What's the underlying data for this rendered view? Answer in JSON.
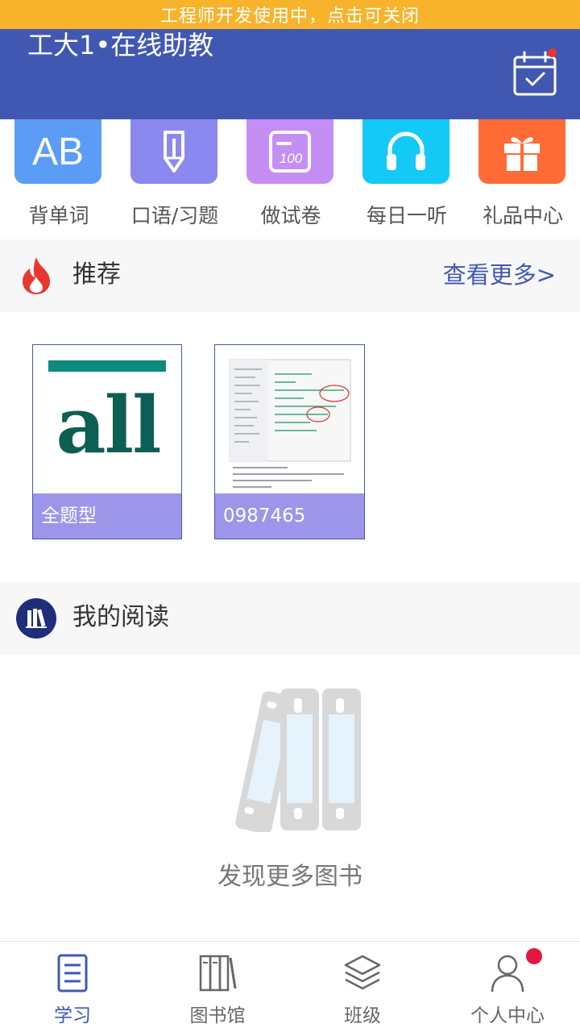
{
  "dev_banner": {
    "text": "工程师开发使用中，点击可关闭"
  },
  "header": {
    "title": "工大1•在线助教",
    "calendar_icon": "calendar-check-icon",
    "badge_color": "#e8352f"
  },
  "quick_actions": [
    {
      "label": "背单词",
      "icon": "ab-letters-icon",
      "color": "#5b9cf7"
    },
    {
      "label": "口语/习题",
      "icon": "pencil-icon",
      "color": "#8b88f0"
    },
    {
      "label": "做试卷",
      "icon": "exam-paper-icon",
      "color": "#c58ef4"
    },
    {
      "label": "每日一听",
      "icon": "headphones-icon",
      "color": "#14c9f5"
    },
    {
      "label": "礼品中心",
      "icon": "gift-icon",
      "color": "#ff6b35"
    }
  ],
  "recommend": {
    "title": "推荐",
    "more": "查看更多>",
    "books": [
      {
        "cover_text": "all",
        "caption": "全题型"
      },
      {
        "caption": "0987465"
      }
    ]
  },
  "my_reading": {
    "title": "我的阅读",
    "empty_text": "发现更多图书"
  },
  "tabs": [
    {
      "label": "学习",
      "icon": "study-notebook-icon",
      "active": true
    },
    {
      "label": "图书馆",
      "icon": "library-books-icon",
      "active": false
    },
    {
      "label": "班级",
      "icon": "layers-icon",
      "active": false
    },
    {
      "label": "个人中心",
      "icon": "person-icon",
      "active": false
    }
  ],
  "colors": {
    "primary": "#4158b3",
    "banner": "#f7b32b",
    "badge": "#e3173d"
  }
}
